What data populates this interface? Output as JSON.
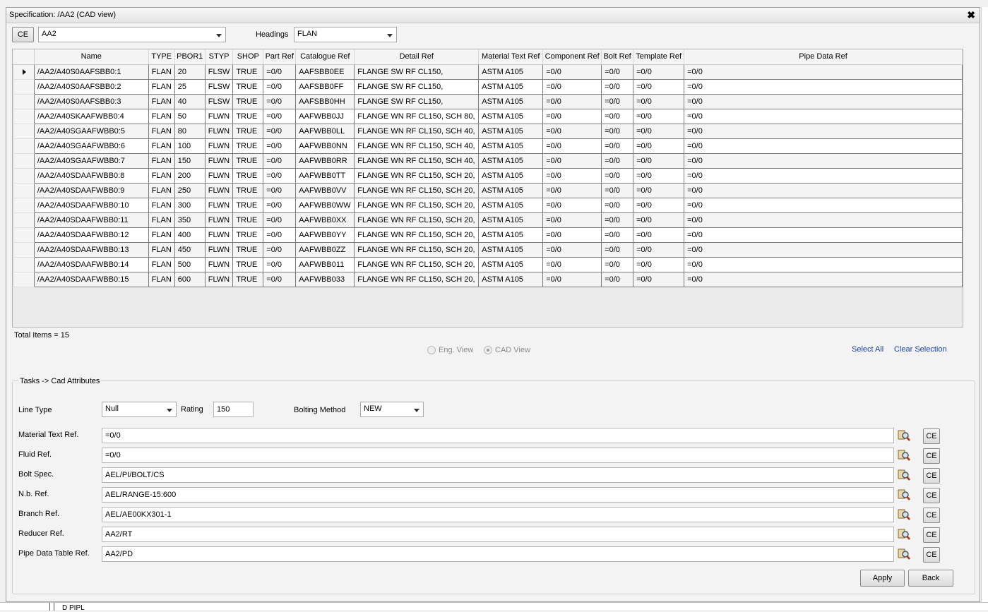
{
  "window": {
    "title": "Specification: /AA2 (CAD view)",
    "close_glyph": "✖"
  },
  "toolbar": {
    "ce_label": "CE",
    "spec_value": "AA2",
    "headings_label": "Headings",
    "headings_value": "FLAN"
  },
  "grid": {
    "columns": [
      "Name",
      "TYPE",
      "PBOR1",
      "STYP",
      "SHOP",
      "Part Ref",
      "Catalogue Ref",
      "Detail Ref",
      "Material Text Ref",
      "Component Ref",
      "Bolt Ref",
      "Template Ref",
      "Pipe Data Ref"
    ],
    "rows": [
      [
        "/AA2/A40S0AAFSBB0:1",
        "FLAN",
        "20",
        "FLSW",
        "TRUE",
        "=0/0",
        "AAFSBB0EE",
        "FLANGE SW RF CL150,",
        "ASTM A105",
        "=0/0",
        "=0/0",
        "=0/0",
        "=0/0"
      ],
      [
        "/AA2/A40S0AAFSBB0:2",
        "FLAN",
        "25",
        "FLSW",
        "TRUE",
        "=0/0",
        "AAFSBB0FF",
        "FLANGE SW RF CL150,",
        "ASTM A105",
        "=0/0",
        "=0/0",
        "=0/0",
        "=0/0"
      ],
      [
        "/AA2/A40S0AAFSBB0:3",
        "FLAN",
        "40",
        "FLSW",
        "TRUE",
        "=0/0",
        "AAFSBB0HH",
        "FLANGE SW RF CL150,",
        "ASTM A105",
        "=0/0",
        "=0/0",
        "=0/0",
        "=0/0"
      ],
      [
        "/AA2/A40SKAAFWBB0:4",
        "FLAN",
        "50",
        "FLWN",
        "TRUE",
        "=0/0",
        "AAFWBB0JJ",
        "FLANGE WN RF CL150, SCH 80,",
        "ASTM A105",
        "=0/0",
        "=0/0",
        "=0/0",
        "=0/0"
      ],
      [
        "/AA2/A40SGAAFWBB0:5",
        "FLAN",
        "80",
        "FLWN",
        "TRUE",
        "=0/0",
        "AAFWBB0LL",
        "FLANGE WN RF CL150, SCH 40,",
        "ASTM A105",
        "=0/0",
        "=0/0",
        "=0/0",
        "=0/0"
      ],
      [
        "/AA2/A40SGAAFWBB0:6",
        "FLAN",
        "100",
        "FLWN",
        "TRUE",
        "=0/0",
        "AAFWBB0NN",
        "FLANGE WN RF CL150, SCH 40,",
        "ASTM A105",
        "=0/0",
        "=0/0",
        "=0/0",
        "=0/0"
      ],
      [
        "/AA2/A40SGAAFWBB0:7",
        "FLAN",
        "150",
        "FLWN",
        "TRUE",
        "=0/0",
        "AAFWBB0RR",
        "FLANGE WN RF CL150, SCH 40,",
        "ASTM A105",
        "=0/0",
        "=0/0",
        "=0/0",
        "=0/0"
      ],
      [
        "/AA2/A40SDAAFWBB0:8",
        "FLAN",
        "200",
        "FLWN",
        "TRUE",
        "=0/0",
        "AAFWBB0TT",
        "FLANGE WN RF CL150, SCH 20,",
        "ASTM A105",
        "=0/0",
        "=0/0",
        "=0/0",
        "=0/0"
      ],
      [
        "/AA2/A40SDAAFWBB0:9",
        "FLAN",
        "250",
        "FLWN",
        "TRUE",
        "=0/0",
        "AAFWBB0VV",
        "FLANGE WN RF CL150, SCH 20,",
        "ASTM A105",
        "=0/0",
        "=0/0",
        "=0/0",
        "=0/0"
      ],
      [
        "/AA2/A40SDAAFWBB0:10",
        "FLAN",
        "300",
        "FLWN",
        "TRUE",
        "=0/0",
        "AAFWBB0WW",
        "FLANGE WN RF CL150, SCH 20,",
        "ASTM A105",
        "=0/0",
        "=0/0",
        "=0/0",
        "=0/0"
      ],
      [
        "/AA2/A40SDAAFWBB0:11",
        "FLAN",
        "350",
        "FLWN",
        "TRUE",
        "=0/0",
        "AAFWBB0XX",
        "FLANGE WN RF CL150, SCH 20,",
        "ASTM A105",
        "=0/0",
        "=0/0",
        "=0/0",
        "=0/0"
      ],
      [
        "/AA2/A40SDAAFWBB0:12",
        "FLAN",
        "400",
        "FLWN",
        "TRUE",
        "=0/0",
        "AAFWBB0YY",
        "FLANGE WN RF CL150, SCH 20,",
        "ASTM A105",
        "=0/0",
        "=0/0",
        "=0/0",
        "=0/0"
      ],
      [
        "/AA2/A40SDAAFWBB0:13",
        "FLAN",
        "450",
        "FLWN",
        "TRUE",
        "=0/0",
        "AAFWBB0ZZ",
        "FLANGE WN RF CL150, SCH 20,",
        "ASTM A105",
        "=0/0",
        "=0/0",
        "=0/0",
        "=0/0"
      ],
      [
        "/AA2/A40SDAAFWBB0:14",
        "FLAN",
        "500",
        "FLWN",
        "TRUE",
        "=0/0",
        "AAFWBB011",
        "FLANGE WN RF CL150, SCH 20,",
        "ASTM A105",
        "=0/0",
        "=0/0",
        "=0/0",
        "=0/0"
      ],
      [
        "/AA2/A40SDAAFWBB0:15",
        "FLAN",
        "600",
        "FLWN",
        "TRUE",
        "=0/0",
        "AAFWBB033",
        "FLANGE WN RF CL150, SCH 20,",
        "ASTM A105",
        "=0/0",
        "=0/0",
        "=0/0",
        "=0/0"
      ]
    ],
    "current_row": 0
  },
  "status": {
    "total_items": "Total Items = 15"
  },
  "view": {
    "eng_label": "Eng. View",
    "cad_label": "CAD View",
    "selected": "cad",
    "select_all": "Select All",
    "clear_selection": "Clear Selection"
  },
  "tasks": {
    "legend": "Tasks -> Cad Attributes",
    "line_type_label": "Line Type",
    "line_type_value": "Null",
    "rating_label": "Rating",
    "rating_value": "150",
    "bolting_label": "Bolting Method",
    "bolting_value": "NEW",
    "fields": [
      {
        "label": "Material Text Ref.",
        "value": "=0/0"
      },
      {
        "label": "Fluid Ref.",
        "value": "=0/0"
      },
      {
        "label": "Bolt Spec.",
        "value": "AEL/PI/BOLT/CS"
      },
      {
        "label": "N.b. Ref.",
        "value": "AEL/RANGE-15:600"
      },
      {
        "label": "Branch Ref.",
        "value": "AEL/AE00KX301-1"
      },
      {
        "label": "Reducer Ref.",
        "value": "AA2/RT"
      },
      {
        "label": "Pipe Data Table Ref.",
        "value": "AA2/PD"
      }
    ],
    "ce_label": "CE",
    "apply_label": "Apply",
    "back_label": "Back"
  },
  "footer": {
    "partial_text": "D      PIPL"
  }
}
